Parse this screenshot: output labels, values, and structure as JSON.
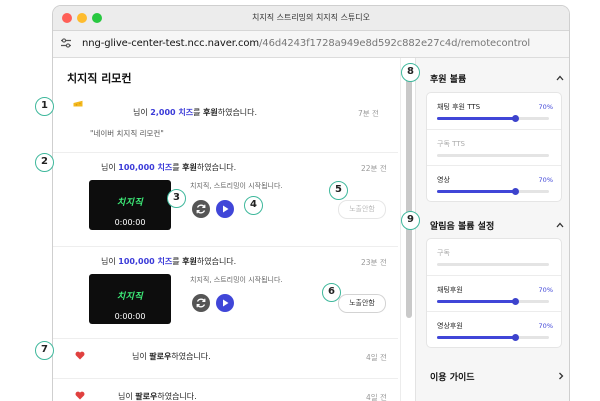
{
  "window": {
    "title": "치지직 스트리밍의 치지직 스튜디오"
  },
  "address": {
    "host": "nng-glive-center-test.ncc.naver.com",
    "path": "/46d4243f1728a949e8d592c882e27c4d/remotecontrol"
  },
  "panel": {
    "title": "치지직 리모컨"
  },
  "items": [
    {
      "msg_pre": "님이 ",
      "amount": "2,000 치즈",
      "msg_mid": "를 ",
      "msg_bold": "후원",
      "msg_post": "하였습니다.",
      "time": "7분 전",
      "quote": "\"네이버 치지직 리모컨\""
    },
    {
      "msg_pre": "님이 ",
      "amount": "100,000 치즈",
      "msg_mid": "를 ",
      "msg_bold": "후원",
      "msg_post": "하였습니다.",
      "time": "22분 전",
      "caption": "치지직, 스트리밍이 시작됩니다.",
      "thumb_logo": "치지직",
      "timecode": "0:00:00",
      "expose_label": "노출안함",
      "expose_enabled": false
    },
    {
      "msg_pre": "님이 ",
      "amount": "100,000 치즈",
      "msg_mid": "를 ",
      "msg_bold": "후원",
      "msg_post": "하였습니다.",
      "time": "23분 전",
      "caption": "치지직, 스트리밍이 시작됩니다.",
      "thumb_logo": "치지직",
      "timecode": "0:00:00",
      "expose_label": "노출안함",
      "expose_enabled": true
    },
    {
      "msg_pre": "님이 ",
      "msg_bold": "팔로우",
      "msg_post": "하였습니다.",
      "time": "4일 전"
    },
    {
      "msg_pre": "님이 ",
      "msg_bold": "팔로우",
      "msg_post": "하였습니다.",
      "time": "4일 전"
    }
  ],
  "callouts": [
    "1",
    "2",
    "3",
    "4",
    "5",
    "6",
    "7",
    "8",
    "9"
  ],
  "sidebar": {
    "donation_volume": {
      "title": "후원 볼륨",
      "rows": [
        {
          "label": "채팅 후원 TTS",
          "percent_label": "70%",
          "value": 70,
          "enabled": true
        },
        {
          "label": "구독 TTS",
          "percent_label": "",
          "value": 0,
          "enabled": false
        },
        {
          "label": "영상",
          "percent_label": "70%",
          "value": 70,
          "enabled": true
        }
      ]
    },
    "alert_volume": {
      "title": "알림음 볼륨 설정",
      "rows": [
        {
          "label": "구독",
          "percent_label": "",
          "value": 0,
          "enabled": false
        },
        {
          "label": "채팅후원",
          "percent_label": "70%",
          "value": 70,
          "enabled": true
        },
        {
          "label": "영상후원",
          "percent_label": "70%",
          "value": 70,
          "enabled": true
        }
      ]
    },
    "guide": {
      "title": "이용 가이드"
    }
  },
  "colors": {
    "accent": "#4046d8",
    "callout_border": "#3fb89c",
    "chzzk_green": "#3ef07a",
    "heart": "#e0413f",
    "cheese": "#f3b81d"
  }
}
